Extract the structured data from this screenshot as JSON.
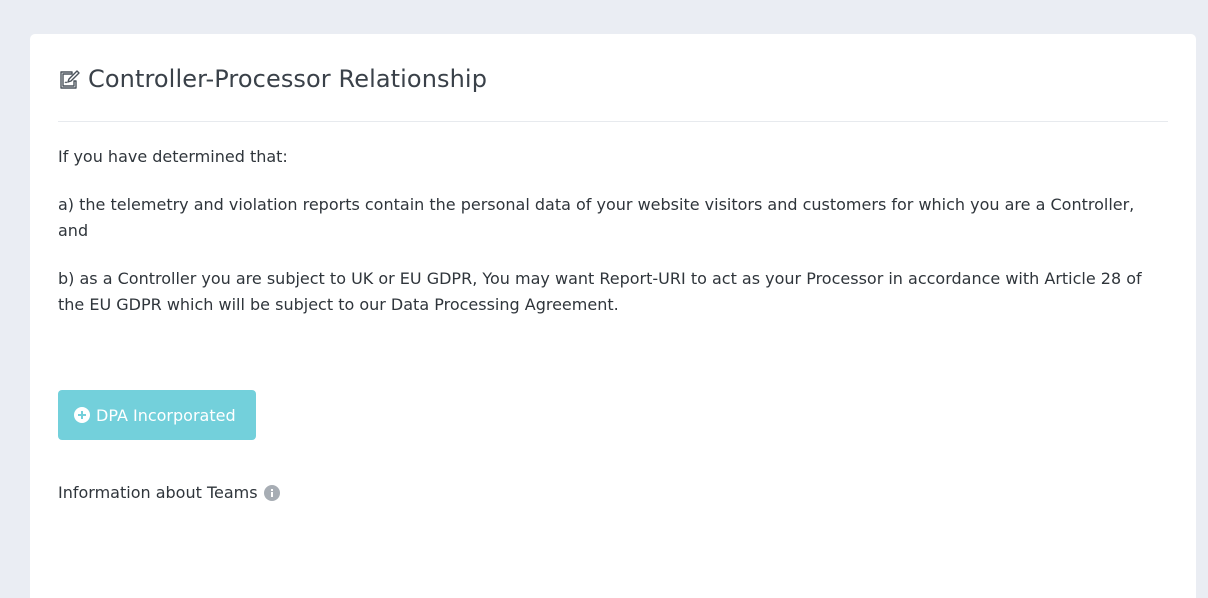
{
  "card": {
    "title": "Controller-Processor Relationship",
    "title_icon": "edit-document-icon",
    "paragraphs": [
      "If you have determined that:",
      "a) the telemetry and violation reports contain the personal data of your website visitors and customers for which you are a Controller, and",
      "b) as a Controller you are subject to UK or EU GDPR, You may want Report-URI to act as your Processor in accordance with Article 28 of the EU GDPR which will be subject to our Data Processing Agreement."
    ],
    "dpa_button": {
      "label": "DPA Incorporated",
      "icon": "plus-circle-icon",
      "color": "#73d0db"
    },
    "teams_info": {
      "label": "Information about Teams",
      "icon": "info-circle-icon"
    }
  }
}
